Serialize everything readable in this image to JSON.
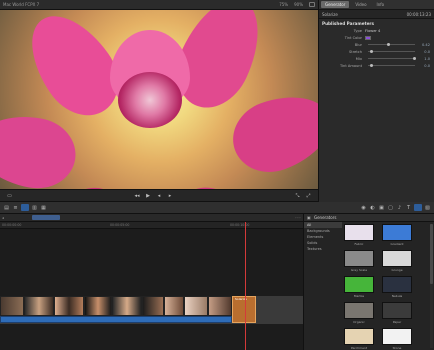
{
  "viewer": {
    "title": "Mac World FCPX 7",
    "zoom": "75%",
    "zoom_extra": "90%",
    "timecode": "00:00:13:23"
  },
  "inspector": {
    "tabs": [
      "Generator",
      "Video",
      "Info"
    ],
    "active_tab": "Generator",
    "clip_name": "Solarize",
    "clip_time": "00:00:13:23",
    "section": "Published Parameters",
    "params": [
      {
        "label": "Type",
        "value": "Flower 4"
      },
      {
        "label": "Tint Color",
        "value": ""
      },
      {
        "label": "Blur",
        "value": "0.42"
      },
      {
        "label": "Stretch",
        "value": "0.0"
      },
      {
        "label": "Mix",
        "value": "1.0"
      },
      {
        "label": "Tint Amount",
        "value": "0.0"
      }
    ]
  },
  "timeline": {
    "ruler_labels": [
      "00:00:00:00",
      "00:00:05:00",
      "00:00:10:00"
    ],
    "generator_clip_label": "Solarize"
  },
  "browser": {
    "title": "Generators",
    "categories": [
      "All",
      "Backgrounds",
      "Elements",
      "Solids",
      "Textures"
    ],
    "selected_category": "All",
    "thumbnails": [
      {
        "label": "Fabric",
        "color": "#e8e0ec"
      },
      {
        "label": "Gradient",
        "color": "#3c7bd6"
      },
      {
        "label": "Grey Scale",
        "color": "#8a8a8a"
      },
      {
        "label": "Grunge",
        "color": "#d9d9d9"
      },
      {
        "label": "Marble",
        "color": "#46b53a"
      },
      {
        "label": "Nebula",
        "color": "#2a3140"
      },
      {
        "label": "Organic",
        "color": "#7a7670"
      },
      {
        "label": "Paper",
        "color": "#3b3b3b"
      },
      {
        "label": "Parchment",
        "color": "#e5d3b2"
      },
      {
        "label": "Stone",
        "color": "#f2f2f2"
      }
    ]
  },
  "colors": {
    "accent_blue": "#2d5d9a",
    "generator_clip": "#b96e2f",
    "playhead": "#d43a3a"
  }
}
